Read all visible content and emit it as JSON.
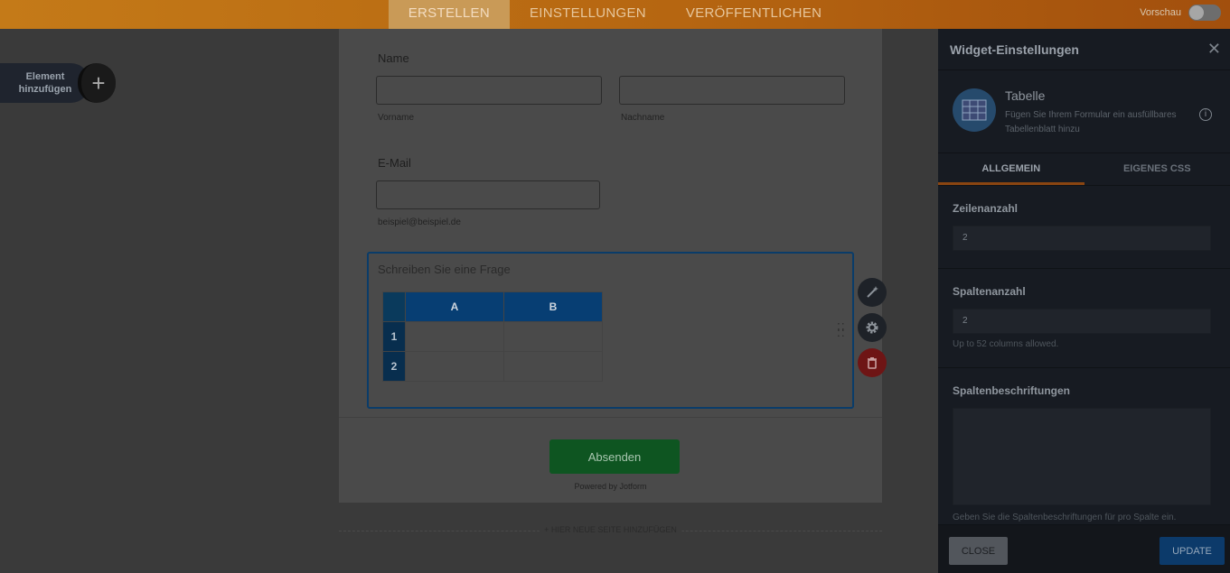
{
  "topbar": {
    "tabs": [
      {
        "label": "ERSTELLEN"
      },
      {
        "label": "EINSTELLUNGEN"
      },
      {
        "label": "VERÖFFENTLICHEN"
      }
    ],
    "preview_label": "Vorschau"
  },
  "add_element": {
    "label_line1": "Element",
    "label_line2": "hinzufügen"
  },
  "form": {
    "name": {
      "label": "Name",
      "first_sublabel": "Vorname",
      "last_sublabel": "Nachname"
    },
    "email": {
      "label": "E-Mail",
      "sublabel": "beispiel@beispiel.de"
    },
    "table_widget": {
      "question": "Schreiben Sie eine Frage",
      "columns": [
        "A",
        "B"
      ],
      "rows": [
        "1",
        "2"
      ]
    },
    "submit_label": "Absenden",
    "powered_by": "Powered by Jotform",
    "new_page": "+ HIER NEUE SEITE HINZUFÜGEN"
  },
  "panel": {
    "title": "Widget-Einstellungen",
    "widget": {
      "name": "Tabelle",
      "description": "Fügen Sie Ihrem Formular ein ausfüllbares Tabellenblatt hinzu"
    },
    "tabs": [
      {
        "label": "ALLGEMEIN"
      },
      {
        "label": "EIGENES CSS"
      }
    ],
    "rows": {
      "label": "Zeilenanzahl",
      "value": "2"
    },
    "cols": {
      "label": "Spaltenanzahl",
      "value": "2",
      "hint": "Up to 52 columns allowed."
    },
    "col_labels": {
      "label": "Spaltenbeschriftungen",
      "hint": "Geben Sie die Spaltenbeschriftungen für pro Spalte ein."
    },
    "close_label": "CLOSE",
    "update_label": "UPDATE"
  },
  "colors": {
    "accent": "#b66611",
    "panel_bg": "#171b22",
    "table_header": "#073e73",
    "submit": "#0e5521"
  }
}
